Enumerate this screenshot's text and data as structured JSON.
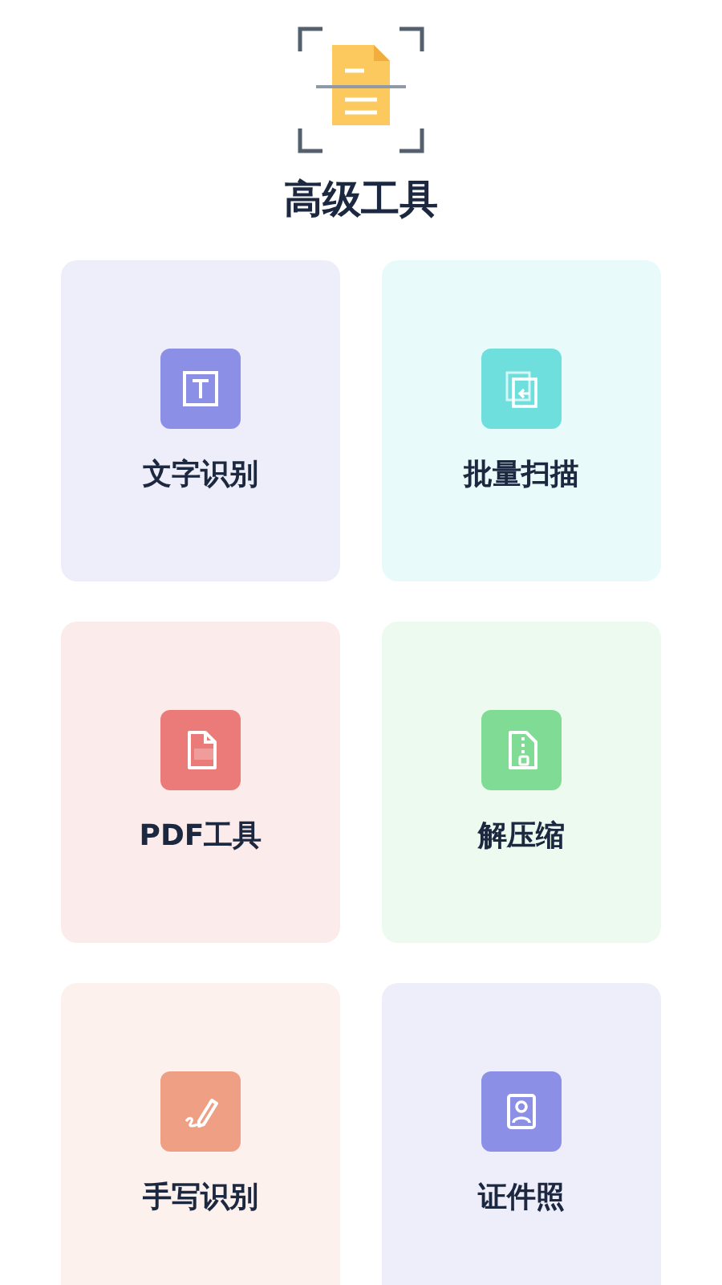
{
  "header": {
    "title": "高级工具"
  },
  "tools": [
    {
      "label": "文字识别",
      "kind": "text",
      "color": "#8b8fe6"
    },
    {
      "label": "批量扫描",
      "kind": "batch",
      "color": "#6fdfde"
    },
    {
      "label": "PDF工具",
      "kind": "pdf",
      "color": "#eb7b78"
    },
    {
      "label": "解压缩",
      "kind": "zip",
      "color": "#80dc94"
    },
    {
      "label": "手写识别",
      "kind": "handwriting",
      "color": "#ef9f84"
    },
    {
      "label": "证件照",
      "kind": "idphoto",
      "color": "#8b8fe6"
    }
  ]
}
